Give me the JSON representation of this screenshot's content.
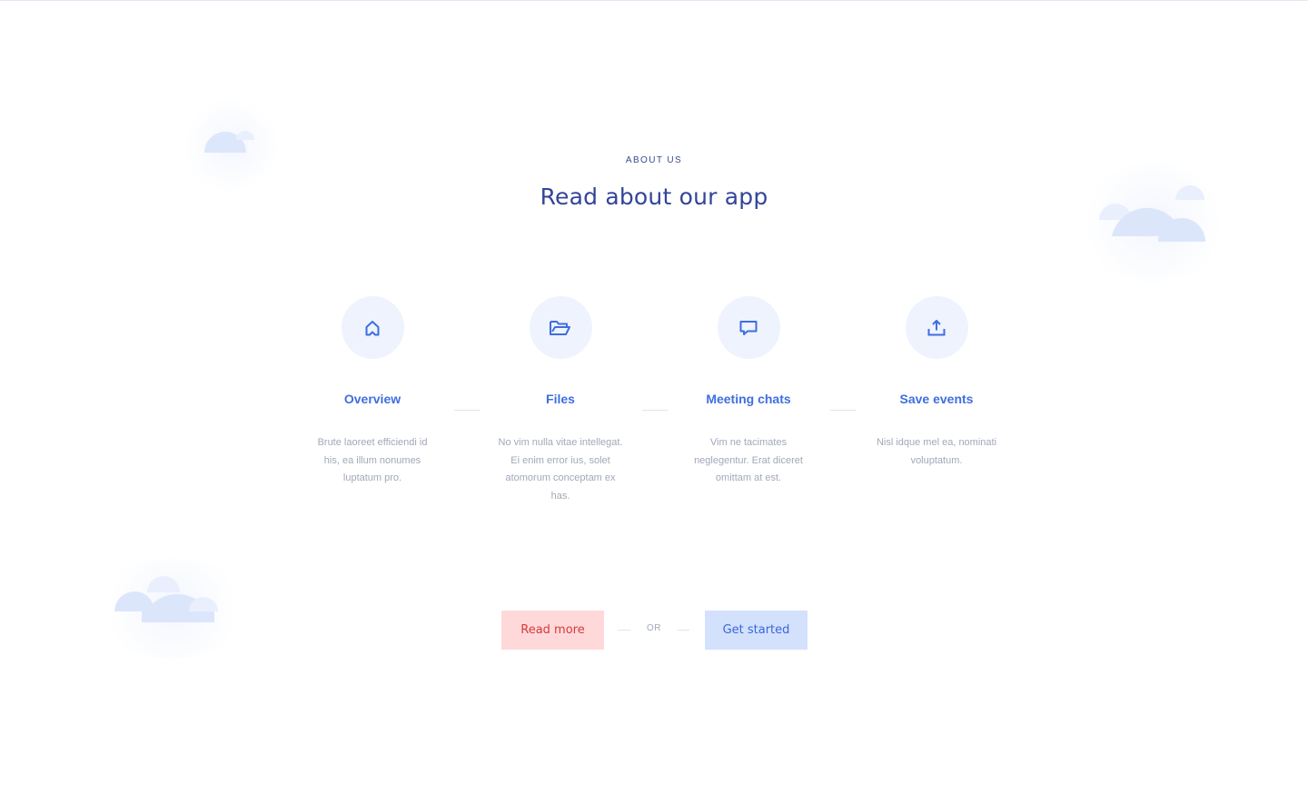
{
  "section": {
    "eyebrow": "ABOUT US",
    "heading": "Read about our app"
  },
  "features": [
    {
      "icon": "home-icon",
      "title": "Overview",
      "description": "Brute laoreet efficiendi id his, ea illum nonumes luptatum pro."
    },
    {
      "icon": "folder-icon",
      "title": "Files",
      "description": "No vim nulla vitae intellegat. Ei enim error ius, solet atomorum conceptam ex has."
    },
    {
      "icon": "chat-icon",
      "title": "Meeting chats",
      "description": "Vim ne tacimates neglegentur. Erat diceret omittam at est."
    },
    {
      "icon": "upload-icon",
      "title": "Save events",
      "description": "Nisl idque mel ea, nominati voluptatum."
    }
  ],
  "cta": {
    "read_more_label": "Read more",
    "or_label": "OR",
    "get_started_label": "Get started"
  },
  "colors": {
    "accent_blue": "#3f6ee0",
    "heading_navy": "#33449a",
    "read_more_bg": "#ffd9d9",
    "read_more_text": "#d8393d",
    "get_started_bg": "#d3e1fc",
    "get_started_text": "#3a67d9",
    "icon_bg": "#eef3fd",
    "cloud": "#dce6fb"
  }
}
